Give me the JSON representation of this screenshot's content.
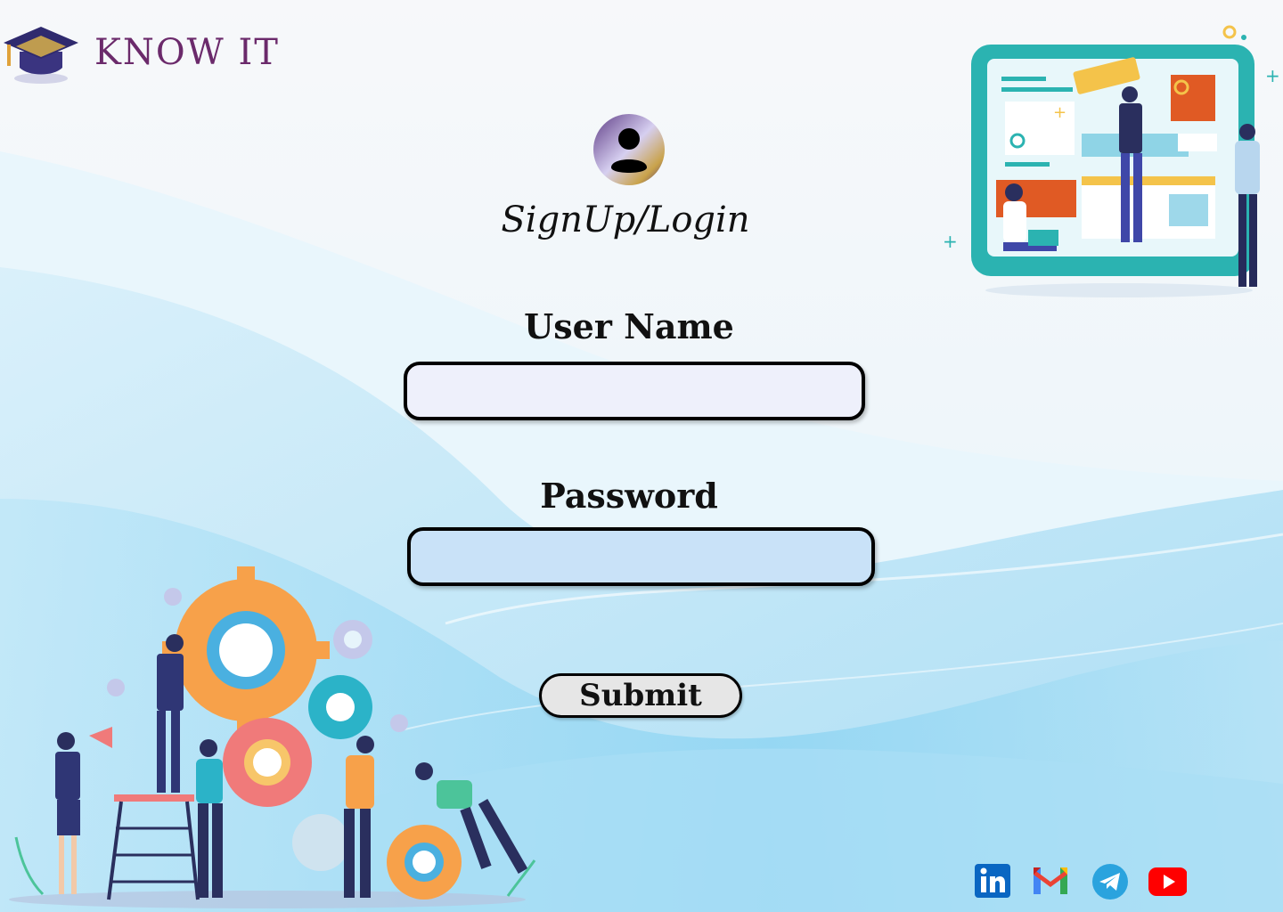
{
  "app": {
    "brand": "KNOW IT"
  },
  "form": {
    "title": "SignUp/Login",
    "username_label": "User Name",
    "username_value": "",
    "password_label": "Password",
    "password_value": "",
    "submit_label": "Submit"
  },
  "social": [
    {
      "icon": "linkedin-icon"
    },
    {
      "icon": "gmail-icon"
    },
    {
      "icon": "telegram-icon"
    },
    {
      "icon": "youtube-icon"
    }
  ],
  "colors": {
    "brand": "#6b2a6b",
    "accent_teal": "#2bb3b1",
    "wave_blue": "#bfe6f7"
  }
}
